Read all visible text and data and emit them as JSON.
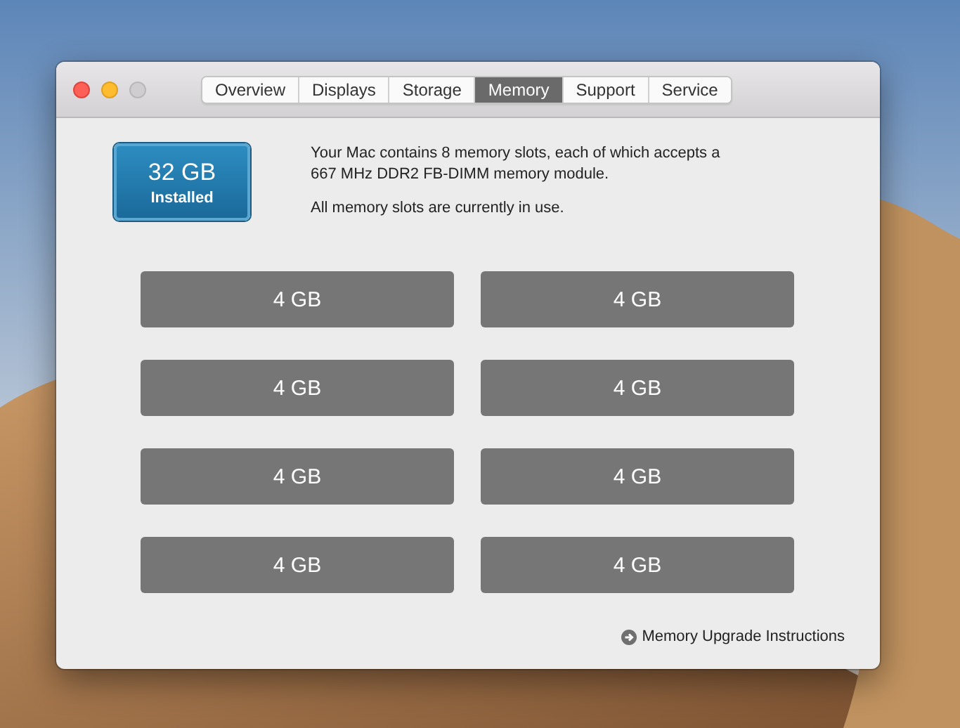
{
  "tabs": [
    {
      "label": "Overview",
      "selected": false
    },
    {
      "label": "Displays",
      "selected": false
    },
    {
      "label": "Storage",
      "selected": false
    },
    {
      "label": "Memory",
      "selected": true
    },
    {
      "label": "Support",
      "selected": false
    },
    {
      "label": "Service",
      "selected": false
    }
  ],
  "installed": {
    "amount": "32 GB",
    "caption": "Installed"
  },
  "description": [
    "Your Mac contains 8 memory slots, each of which accepts a 667 MHz DDR2 FB-DIMM memory module.",
    "All memory slots are currently in use."
  ],
  "slots": [
    {
      "label": "4 GB"
    },
    {
      "label": "4 GB"
    },
    {
      "label": "4 GB"
    },
    {
      "label": "4 GB"
    },
    {
      "label": "4 GB"
    },
    {
      "label": "4 GB"
    },
    {
      "label": "4 GB"
    },
    {
      "label": "4 GB"
    }
  ],
  "upgrade_link": "Memory Upgrade Instructions"
}
